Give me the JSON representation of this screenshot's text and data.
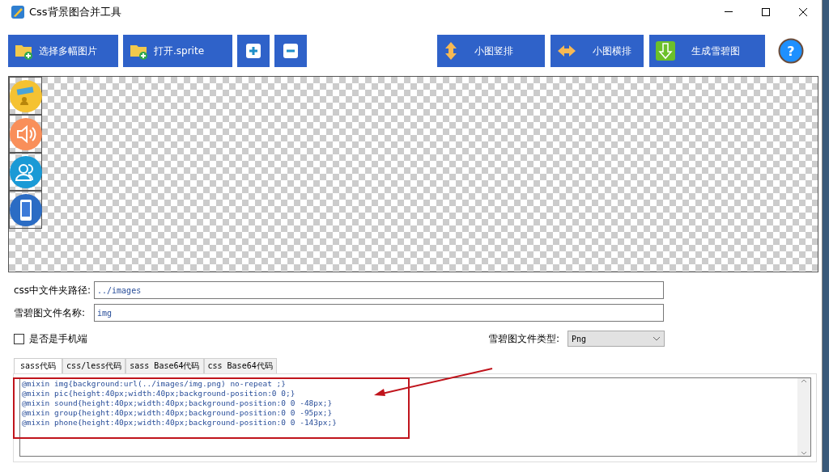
{
  "window": {
    "title": "Css背景图合并工具"
  },
  "toolbar": {
    "left": [
      {
        "kind": "folder",
        "label": "选择多幅图片"
      },
      {
        "kind": "folder",
        "label": "打开.sprite"
      },
      {
        "kind": "plus"
      },
      {
        "kind": "minus"
      }
    ],
    "right": [
      {
        "kind": "vertical",
        "label": "小图竖排"
      },
      {
        "kind": "horizontal",
        "label": "小图横排"
      },
      {
        "kind": "download",
        "label": "生成雪碧图"
      }
    ],
    "help": "?"
  },
  "sprites": [
    {
      "kind": "pic",
      "color": "#f5c232"
    },
    {
      "kind": "sound",
      "color": "#f98f5a"
    },
    {
      "kind": "group",
      "color": "#1a9ad6"
    },
    {
      "kind": "phone",
      "color": "#2b6cc4"
    }
  ],
  "fields": [
    {
      "label": "css中文件夹路径:",
      "value": "../images"
    },
    {
      "label": "雪碧图文件名称:",
      "value": "img"
    }
  ],
  "mobile": {
    "label": "是否是手机端",
    "checked": false
  },
  "file_type": {
    "label": "雪碧图文件类型:",
    "value": "Png"
  },
  "tabs": [
    {
      "label": "sass代码",
      "selected": true
    },
    {
      "label": "css/less代码",
      "selected": false
    },
    {
      "label": "sass Base64代码",
      "selected": false
    },
    {
      "label": "css Base64代码",
      "selected": false
    }
  ],
  "code": [
    "@mixin img{background:url(../images/img.png) no-repeat ;}",
    "@mixin pic{height:40px;width:40px;background-position:0 0;}",
    "@mixin sound{height:40px;width:40px;background-position:0 0 -48px;}",
    "@mixin group{height:40px;width:40px;background-position:0 0 -95px;}",
    "@mixin phone{height:40px;width:40px;background-position:0 0 -143px;}"
  ]
}
